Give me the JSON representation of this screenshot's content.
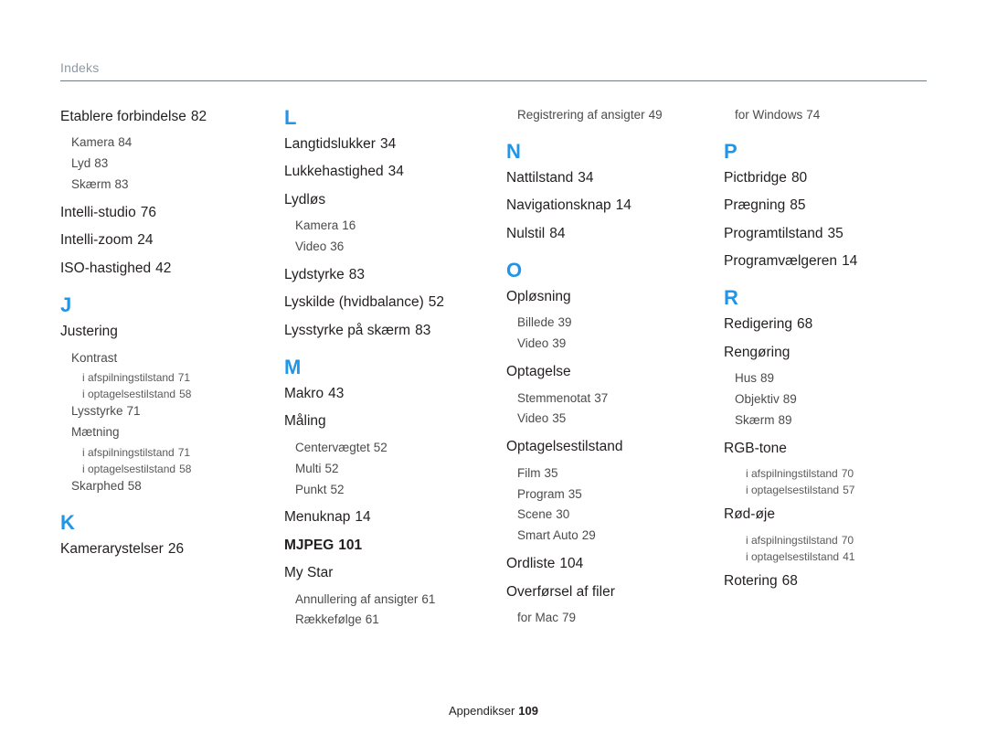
{
  "header": {
    "title": "Indeks"
  },
  "footer": {
    "label": "Appendikser",
    "page": "109"
  },
  "accent_color": "#2196e8",
  "columns": [
    {
      "id": "column-1",
      "blocks": [
        {
          "type": "lvl1",
          "text": "Etablere forbindelse",
          "num": "82"
        },
        {
          "type": "lvl2",
          "text": "Kamera",
          "num": "84"
        },
        {
          "type": "lvl2",
          "text": "Lyd",
          "num": "83"
        },
        {
          "type": "lvl2",
          "text": "Skærm",
          "num": "83"
        },
        {
          "type": "spacer-sm"
        },
        {
          "type": "lvl1",
          "text": "Intelli-studio",
          "num": "76"
        },
        {
          "type": "lvl1",
          "text": "Intelli-zoom",
          "num": "24"
        },
        {
          "type": "lvl1",
          "text": "ISO-hastighed",
          "num": "42"
        },
        {
          "type": "letter",
          "text": "J"
        },
        {
          "type": "lvl1",
          "text": "Justering",
          "num": ""
        },
        {
          "type": "lvl2",
          "text": "Kontrast",
          "num": ""
        },
        {
          "type": "lvl3",
          "text": "i afspilningstilstand",
          "num": "71"
        },
        {
          "type": "lvl3",
          "text": "i optagelsestilstand",
          "num": "58"
        },
        {
          "type": "lvl2",
          "text": "Lysstyrke",
          "num": "71"
        },
        {
          "type": "lvl2",
          "text": "Mætning",
          "num": ""
        },
        {
          "type": "lvl3",
          "text": "i afspilningstilstand",
          "num": "71"
        },
        {
          "type": "lvl3",
          "text": "i optagelsestilstand",
          "num": "58"
        },
        {
          "type": "lvl2",
          "text": "Skarphed",
          "num": "58"
        },
        {
          "type": "letter",
          "text": "K"
        },
        {
          "type": "lvl1",
          "text": "Kamerarystelser",
          "num": "26"
        }
      ]
    },
    {
      "id": "column-2",
      "blocks": [
        {
          "type": "letter-first",
          "text": "L"
        },
        {
          "type": "lvl1",
          "text": "Langtidslukker",
          "num": "34"
        },
        {
          "type": "lvl1",
          "text": "Lukkehastighed",
          "num": "34"
        },
        {
          "type": "lvl1",
          "text": "Lydløs",
          "num": ""
        },
        {
          "type": "lvl2",
          "text": "Kamera",
          "num": "16"
        },
        {
          "type": "lvl2",
          "text": "Video",
          "num": "36"
        },
        {
          "type": "spacer-sm"
        },
        {
          "type": "lvl1",
          "text": "Lydstyrke",
          "num": "83"
        },
        {
          "type": "lvl1",
          "text": "Lyskilde (hvidbalance)",
          "num": "52"
        },
        {
          "type": "lvl1",
          "text": "Lysstyrke på skærm",
          "num": "83"
        },
        {
          "type": "letter",
          "text": "M"
        },
        {
          "type": "lvl1",
          "text": "Makro",
          "num": "43"
        },
        {
          "type": "lvl1",
          "text": "Måling",
          "num": ""
        },
        {
          "type": "lvl2",
          "text": "Centervægtet",
          "num": "52"
        },
        {
          "type": "lvl2",
          "text": "Multi",
          "num": "52"
        },
        {
          "type": "lvl2",
          "text": "Punkt",
          "num": "52"
        },
        {
          "type": "spacer-sm"
        },
        {
          "type": "lvl1",
          "text": "Menuknap",
          "num": "14"
        },
        {
          "type": "lvl1-bold",
          "text": "MJPEG",
          "num": "101"
        },
        {
          "type": "lvl1",
          "text": "My Star",
          "num": ""
        },
        {
          "type": "lvl2",
          "text": "Annullering af ansigter",
          "num": "61"
        },
        {
          "type": "lvl2",
          "text": "Rækkefølge",
          "num": "61"
        }
      ]
    },
    {
      "id": "column-3",
      "blocks": [
        {
          "type": "lvl2-top",
          "text": "Registrering af ansigter",
          "num": "49"
        },
        {
          "type": "letter",
          "text": "N"
        },
        {
          "type": "lvl1",
          "text": "Nattilstand",
          "num": "34"
        },
        {
          "type": "lvl1",
          "text": "Navigationsknap",
          "num": "14"
        },
        {
          "type": "lvl1",
          "text": "Nulstil",
          "num": "84"
        },
        {
          "type": "letter",
          "text": "O"
        },
        {
          "type": "lvl1",
          "text": "Opløsning",
          "num": ""
        },
        {
          "type": "lvl2",
          "text": "Billede",
          "num": "39"
        },
        {
          "type": "lvl2",
          "text": "Video",
          "num": "39"
        },
        {
          "type": "spacer-sm"
        },
        {
          "type": "lvl1",
          "text": "Optagelse",
          "num": ""
        },
        {
          "type": "lvl2",
          "text": "Stemmenotat",
          "num": "37"
        },
        {
          "type": "lvl2",
          "text": "Video",
          "num": "35"
        },
        {
          "type": "spacer-sm"
        },
        {
          "type": "lvl1",
          "text": "Optagelsestilstand",
          "num": ""
        },
        {
          "type": "lvl2",
          "text": "Film",
          "num": "35"
        },
        {
          "type": "lvl2",
          "text": "Program",
          "num": "35"
        },
        {
          "type": "lvl2",
          "text": "Scene",
          "num": "30"
        },
        {
          "type": "lvl2",
          "text": "Smart Auto",
          "num": "29"
        },
        {
          "type": "spacer-sm"
        },
        {
          "type": "lvl1",
          "text": "Ordliste",
          "num": "104"
        },
        {
          "type": "lvl1",
          "text": "Overførsel af filer",
          "num": ""
        },
        {
          "type": "lvl2",
          "text": "for Mac",
          "num": "79"
        }
      ]
    },
    {
      "id": "column-4",
      "blocks": [
        {
          "type": "lvl2-top",
          "text": "for Windows",
          "num": "74"
        },
        {
          "type": "letter",
          "text": "P"
        },
        {
          "type": "lvl1",
          "text": "Pictbridge",
          "num": "80"
        },
        {
          "type": "lvl1",
          "text": "Prægning",
          "num": "85"
        },
        {
          "type": "lvl1",
          "text": "Programtilstand",
          "num": "35"
        },
        {
          "type": "lvl1",
          "text": "Programvælgeren",
          "num": "14"
        },
        {
          "type": "letter",
          "text": "R"
        },
        {
          "type": "lvl1",
          "text": "Redigering",
          "num": "68"
        },
        {
          "type": "lvl1",
          "text": "Rengøring",
          "num": ""
        },
        {
          "type": "lvl2",
          "text": "Hus",
          "num": "89"
        },
        {
          "type": "lvl2",
          "text": "Objektiv",
          "num": "89"
        },
        {
          "type": "lvl2",
          "text": "Skærm",
          "num": "89"
        },
        {
          "type": "spacer-sm"
        },
        {
          "type": "lvl1",
          "text": "RGB-tone",
          "num": ""
        },
        {
          "type": "lvl3",
          "text": "i afspilningstilstand",
          "num": "70"
        },
        {
          "type": "lvl3",
          "text": "i optagelsestilstand",
          "num": "57"
        },
        {
          "type": "spacer-sm"
        },
        {
          "type": "lvl1",
          "text": "Rød-øje",
          "num": ""
        },
        {
          "type": "lvl3",
          "text": "i afspilningstilstand",
          "num": "70"
        },
        {
          "type": "lvl3",
          "text": "i optagelsestilstand",
          "num": "41"
        },
        {
          "type": "spacer-sm"
        },
        {
          "type": "lvl1",
          "text": "Rotering",
          "num": "68"
        }
      ]
    }
  ]
}
